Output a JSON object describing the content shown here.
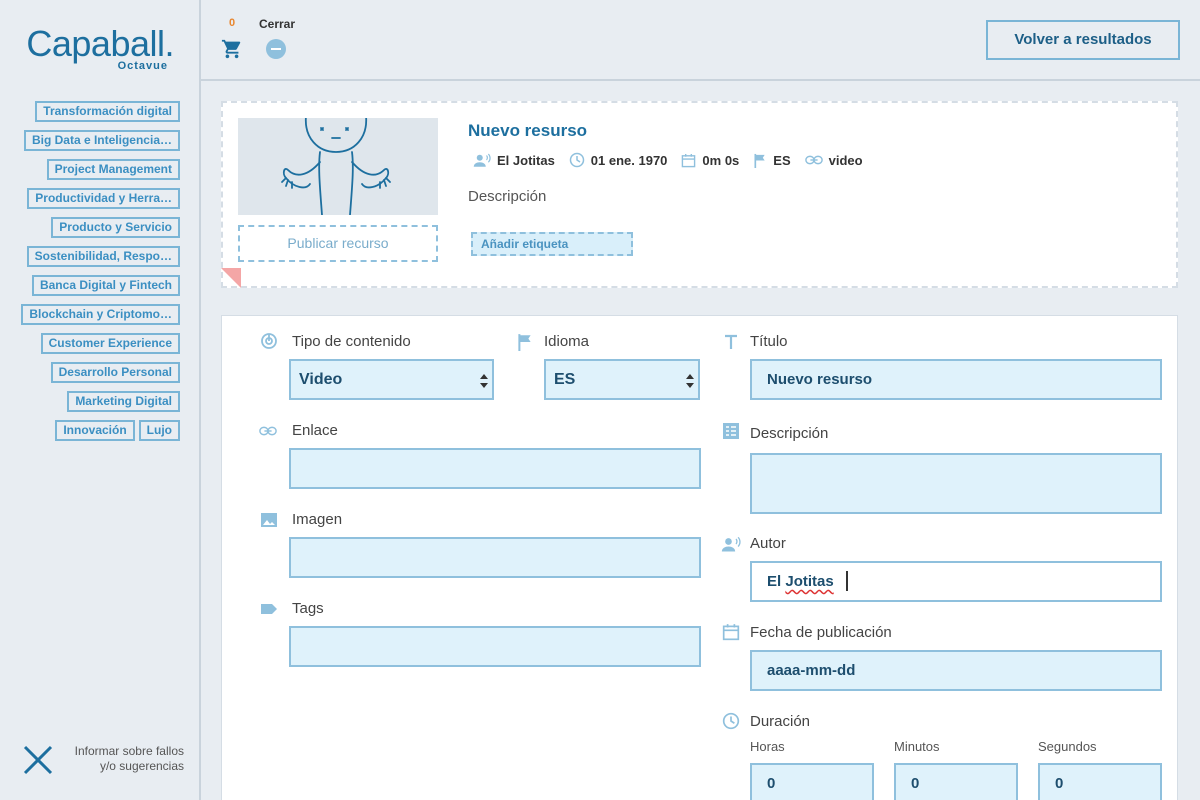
{
  "sidebar": {
    "logo_main": "Capaball.",
    "logo_sub": "Octavue",
    "categories": [
      [
        "Transformación digital"
      ],
      [
        "Big Data e Inteligencia…"
      ],
      [
        "Project Management"
      ],
      [
        "Productividad y Herra…"
      ],
      [
        "Producto y Servicio"
      ],
      [
        "Sostenibilidad, Respo…"
      ],
      [
        "Banca Digital y Fintech"
      ],
      [
        "Blockchain y Criptomo…"
      ],
      [
        "Customer Experience"
      ],
      [
        "Desarrollo Personal"
      ],
      [
        "Marketing Digital"
      ],
      [
        "Innovación",
        "Lujo"
      ]
    ],
    "feedback_line1": "Informar sobre fallos",
    "feedback_line2": "y/o sugerencias"
  },
  "topbar": {
    "cart_count": "0",
    "close_label": "Cerrar",
    "back_button": "Volver a resultados"
  },
  "preview": {
    "publish_label": "Publicar recurso",
    "title": "Nuevo resurso",
    "author": "El Jotitas",
    "date": "01 ene. 1970",
    "duration": "0m 0s",
    "language": "ES",
    "type": "video",
    "description": "Descripción",
    "add_tag": "Añadir etiqueta"
  },
  "form": {
    "content_type_label": "Tipo de contenido",
    "content_type_value": "Video",
    "language_label": "Idioma",
    "language_value": "ES",
    "title_label": "Título",
    "title_value": "Nuevo resurso",
    "link_label": "Enlace",
    "link_value": "",
    "description_label": "Descripción",
    "description_value": "",
    "image_label": "Imagen",
    "image_value": "",
    "author_label": "Autor",
    "author_first": "El",
    "author_second": "Jotitas",
    "tags_label": "Tags",
    "tags_value": "",
    "pubdate_label": "Fecha de publicación",
    "pubdate_value": "aaaa-mm-dd",
    "duration_label": "Duración",
    "hours_label": "Horas",
    "hours_value": "0",
    "minutes_label": "Minutos",
    "minutes_value": "0",
    "seconds_label": "Segundos",
    "seconds_value": "0"
  },
  "colors": {
    "brand": "#1d6f9f",
    "accent_light": "#dff2fb",
    "border_accent": "#8fc0dd",
    "cart_count": "#e8862f"
  },
  "icons": [
    "shopping-cart-icon",
    "minus-circle-icon",
    "close-x-icon",
    "author-icon",
    "clock-icon",
    "calendar-icon",
    "flag-icon",
    "link-icon",
    "content-type-icon",
    "text-icon",
    "description-icon",
    "image-icon",
    "tag-icon"
  ]
}
